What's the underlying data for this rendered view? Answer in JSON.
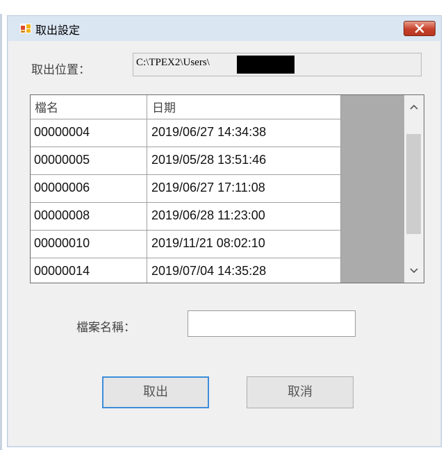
{
  "window": {
    "title": "取出設定"
  },
  "location": {
    "label": "取出位置：",
    "value": "C:\\TPEX2\\Users\\"
  },
  "grid": {
    "columns": [
      "檔名",
      "日期"
    ],
    "rows": [
      {
        "name": "00000004",
        "date": "2019/06/27 14:34:38"
      },
      {
        "name": "00000005",
        "date": "2019/05/28 13:51:46"
      },
      {
        "name": "00000006",
        "date": "2019/06/27 17:11:08"
      },
      {
        "name": "00000008",
        "date": "2019/06/28 11:23:00"
      },
      {
        "name": "00000010",
        "date": "2019/11/21 08:02:10"
      },
      {
        "name": "00000014",
        "date": "2019/07/04 14:35:28"
      }
    ]
  },
  "filename": {
    "label": "檔案名稱：",
    "value": ""
  },
  "buttons": {
    "ok_label": "取出",
    "cancel_label": "取消"
  },
  "colors": {
    "title_bar": "#dbe6f3",
    "close_button": "#c6412b",
    "focus_border": "#3c8ddb",
    "grid_background": "#ababab"
  },
  "icons": {
    "app": "app-window-icon",
    "close": "close-icon",
    "scroll_up": "chevron-up-icon",
    "scroll_down": "chevron-down-icon"
  }
}
